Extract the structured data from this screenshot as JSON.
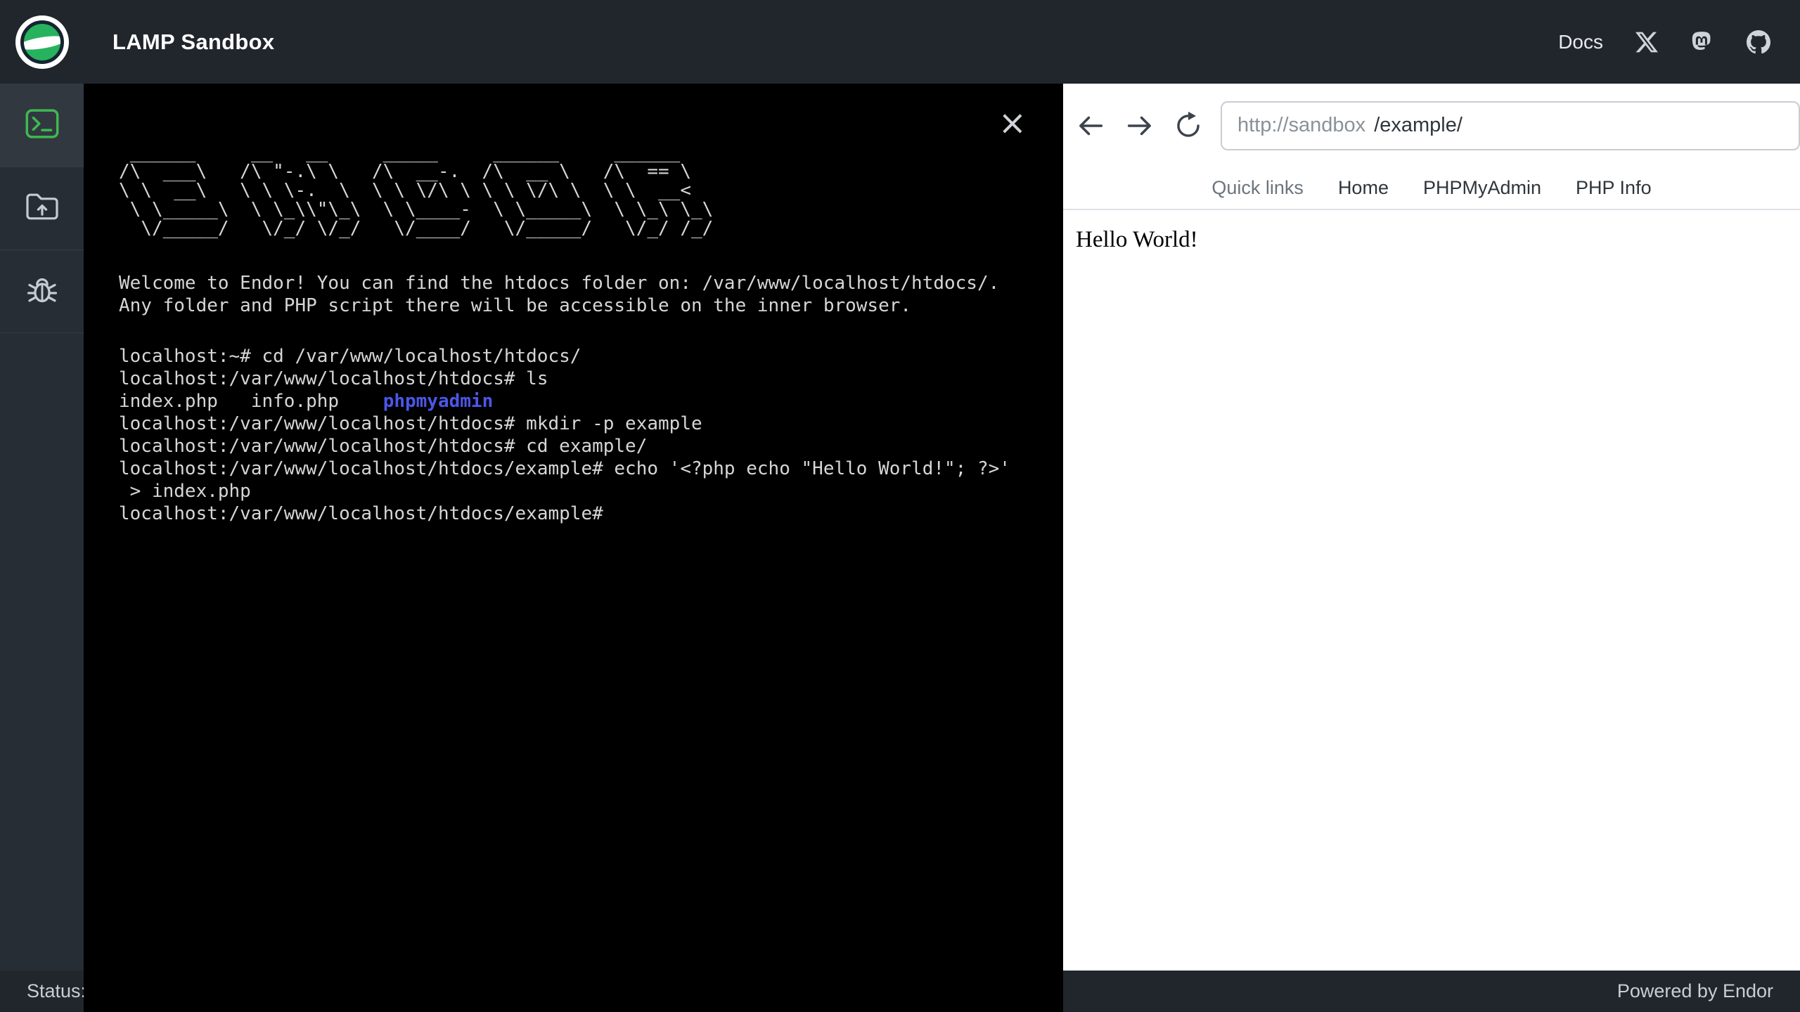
{
  "topbar": {
    "title": "LAMP Sandbox",
    "docs_label": "Docs",
    "icon_names": [
      "x-icon",
      "mastodon-icon",
      "github-icon"
    ]
  },
  "sidebar": {
    "items": [
      {
        "name": "terminal",
        "active": true
      },
      {
        "name": "file-upload",
        "active": false
      },
      {
        "name": "debug",
        "active": false
      }
    ]
  },
  "terminal": {
    "close_icon": "×",
    "ascii_logo": " ______     __   __     _____     ______     ______\n/\\  ___\\   /\\ \"-.\\ \\   /\\  __-.  /\\  __ \\   /\\  == \\\n\\ \\  __\\   \\ \\ \\-.  \\  \\ \\ \\/\\ \\ \\ \\ \\/\\ \\  \\ \\  __<\n \\ \\_____\\  \\ \\_\\\\\"\\_\\  \\ \\____-  \\ \\_____\\  \\ \\_\\ \\_\\\n  \\/_____/   \\/_/ \\/_/   \\/____/   \\/_____/   \\/_/ /_/",
    "welcome_line_1": "Welcome to Endor! You can find the htdocs folder on: /var/www/localhost/htdocs/.",
    "welcome_line_2": "Any folder and PHP script there will be accessible on the inner browser.",
    "command_1": "localhost:~# cd /var/www/localhost/htdocs/",
    "command_2": "localhost:/var/www/localhost/htdocs# ls",
    "ls_output_files": "index.php   info.php    ",
    "ls_output_dir": "phpmyadmin",
    "command_3": "localhost:/var/www/localhost/htdocs# mkdir -p example",
    "command_4": "localhost:/var/www/localhost/htdocs# cd example/",
    "command_5": "localhost:/var/www/localhost/htdocs/example# echo '<?php echo \"Hello World!\"; ?>'",
    "command_5_wrapped": " > index.php",
    "prompt": "localhost:/var/www/localhost/htdocs/example#"
  },
  "browser": {
    "url_host": "http://sandbox",
    "url_path": "/example/",
    "quick_links_label": "Quick links",
    "link_home": "Home",
    "link_phpmyadmin": "PHPMyAdmin",
    "link_phpinfo": "PHP Info",
    "page_content": "Hello World!"
  },
  "statusbar": {
    "status_label": "Status:",
    "powered_by": "Powered by Endor"
  },
  "colors": {
    "accent_green": "#3fb950",
    "chrome_dark": "#21262d",
    "terminal_dir_blue": "#4b57e8"
  }
}
